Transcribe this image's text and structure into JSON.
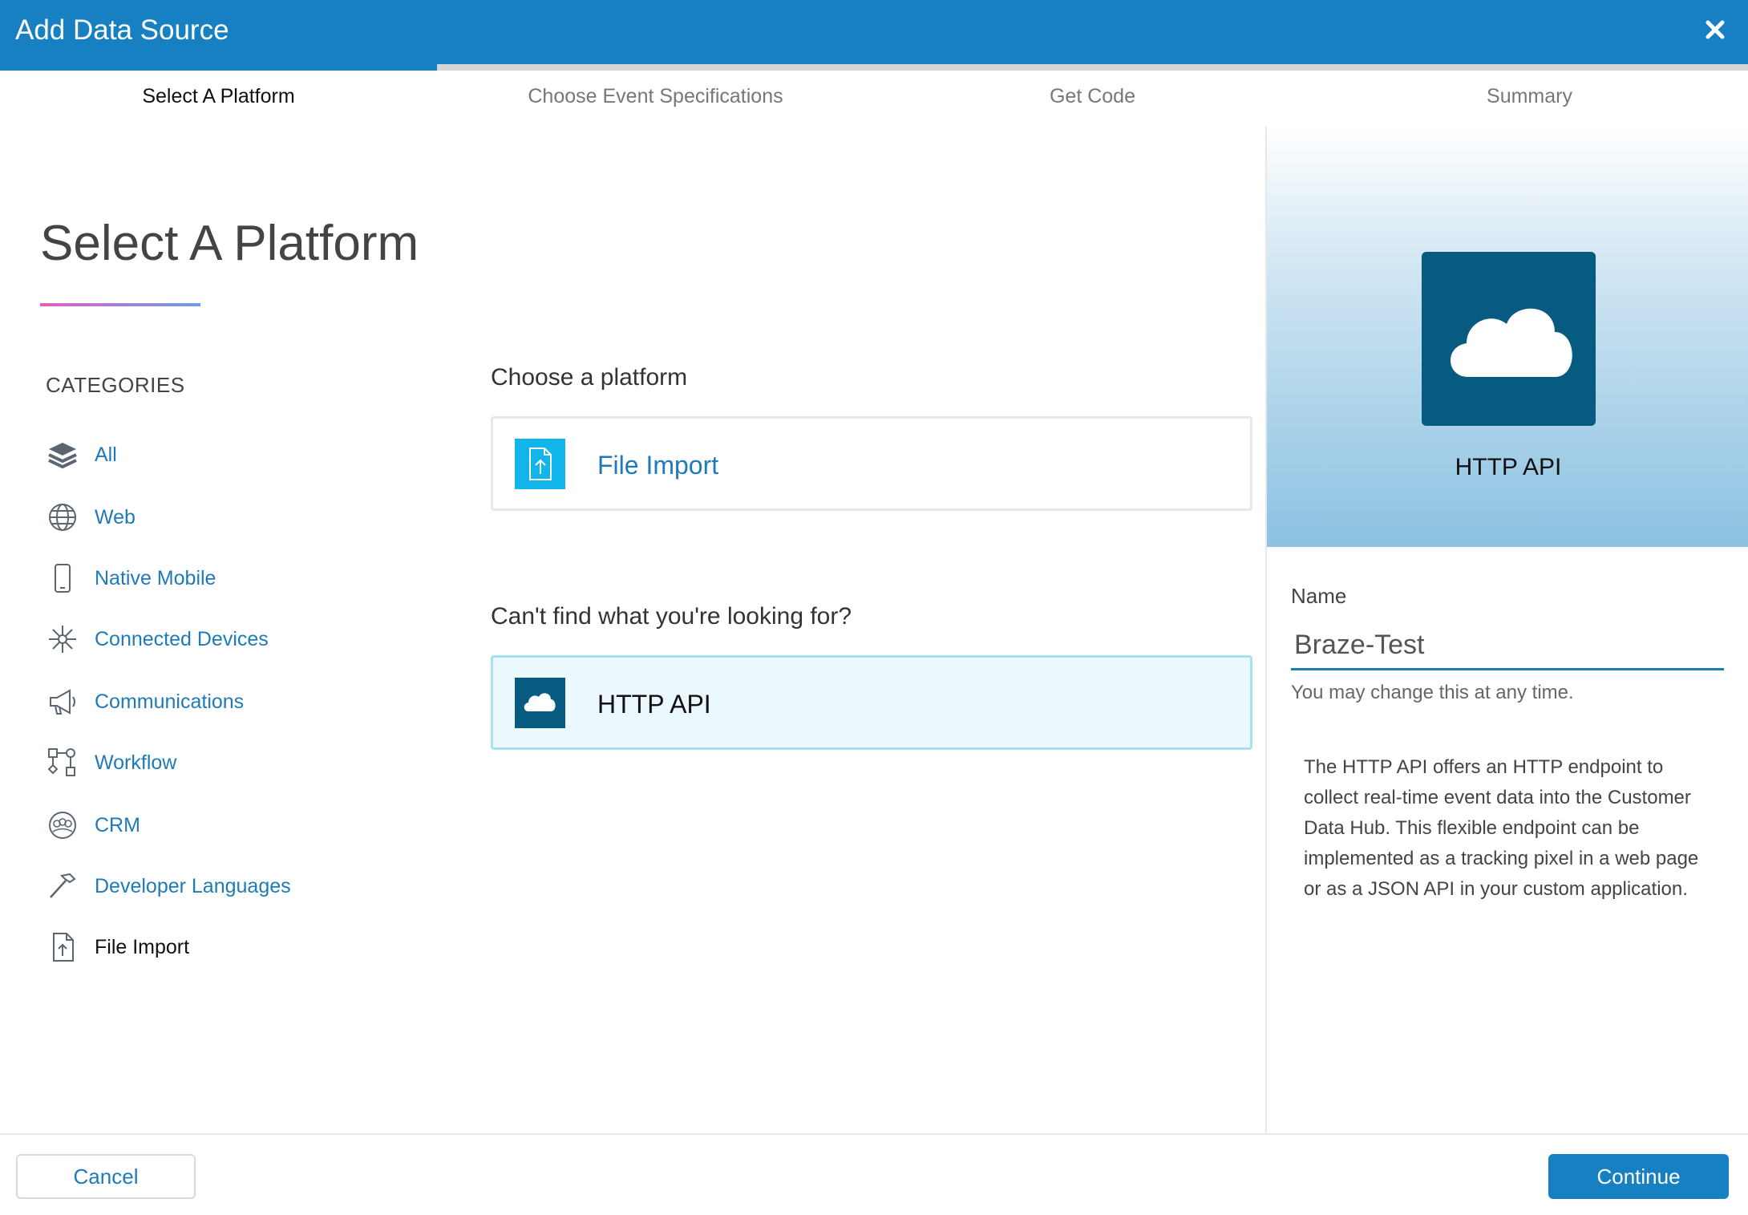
{
  "window": {
    "title": "Add Data Source",
    "close_icon": "close-icon"
  },
  "wizard": {
    "progress_fraction": 0.25,
    "steps": [
      {
        "label": "Select A Platform",
        "state": "active"
      },
      {
        "label": "Choose Event Specifications",
        "state": "inactive"
      },
      {
        "label": "Get Code",
        "state": "inactive"
      },
      {
        "label": "Summary",
        "state": "inactive"
      }
    ]
  },
  "main": {
    "heading": "Select A Platform",
    "categories_title": "CATEGORIES",
    "categories": [
      {
        "label": "All",
        "icon": "layers-icon"
      },
      {
        "label": "Web",
        "icon": "globe-icon"
      },
      {
        "label": "Native Mobile",
        "icon": "mobile-phone-icon"
      },
      {
        "label": "Connected Devices",
        "icon": "connected-devices-icon"
      },
      {
        "label": "Communications",
        "icon": "megaphone-icon"
      },
      {
        "label": "Workflow",
        "icon": "workflow-icon"
      },
      {
        "label": "CRM",
        "icon": "crm-people-icon"
      },
      {
        "label": "Developer Languages",
        "icon": "hammer-icon"
      },
      {
        "label": "File Import",
        "icon": "file-upload-icon",
        "active": true
      }
    ],
    "choose_label": "Choose a platform",
    "platform_card": {
      "label": "File Import",
      "icon": "file-upload-icon"
    },
    "cant_find_label": "Can't find what you're looking for?",
    "fallback_card": {
      "label": "HTTP API",
      "icon": "cloud-icon",
      "selected": true
    }
  },
  "side": {
    "selected_title": "HTTP API",
    "selected_icon": "cloud-icon",
    "name_label": "Name",
    "name_value": "Braze-Test",
    "name_hint": "You may change this at any time.",
    "description": "The HTTP API offers an HTTP endpoint to collect real-time event data into the Customer Data Hub. This flexible endpoint can be implemented as a tracking pixel in a web page or as a JSON API in your custom application."
  },
  "footer": {
    "cancel_label": "Cancel",
    "continue_label": "Continue"
  },
  "colors": {
    "brand_blue": "#1780c2",
    "link_blue": "#1f7ab8",
    "selected_card_bg": "#ebf8fd",
    "icon_dark_blue": "#075a80",
    "file_icon_cyan": "#12b5ea"
  }
}
